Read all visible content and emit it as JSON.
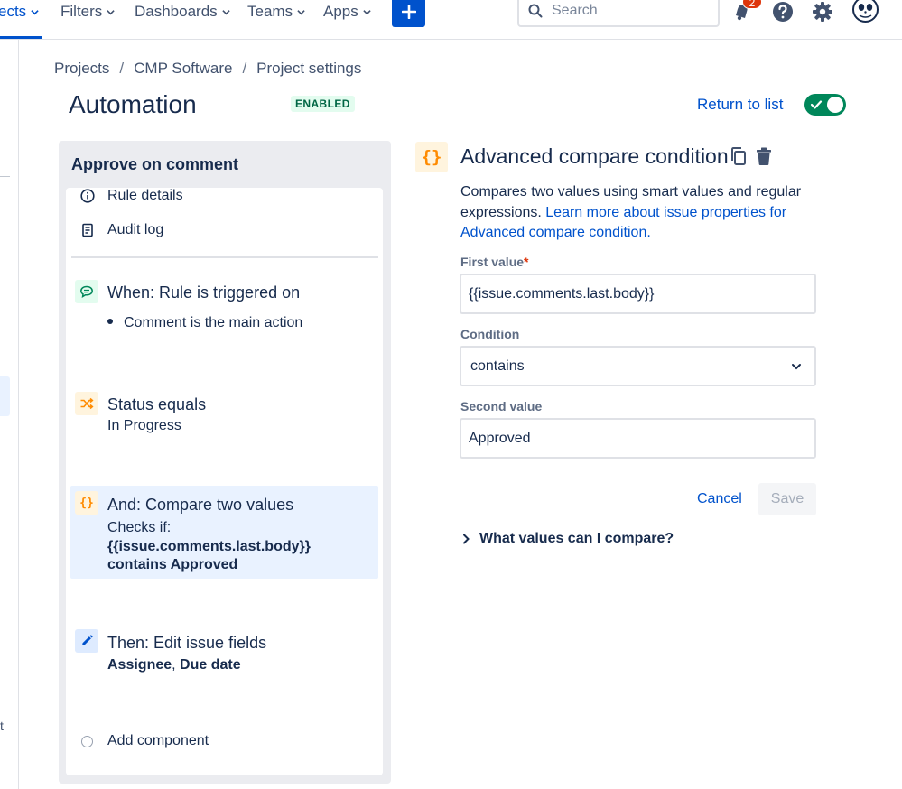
{
  "nav": {
    "items": [
      {
        "label": "ects"
      },
      {
        "label": "Filters"
      },
      {
        "label": "Dashboards"
      },
      {
        "label": "Teams"
      },
      {
        "label": "Apps"
      }
    ],
    "search_placeholder": "Search",
    "notification_count": "2"
  },
  "left_rail": {
    "truncated_text": "t"
  },
  "breadcrumb": [
    "Projects",
    "CMP Software",
    "Project settings"
  ],
  "page": {
    "title": "Automation",
    "status_badge": "ENABLED",
    "return_link": "Return to list",
    "rule_enabled": true
  },
  "rule": {
    "name": "Approve on comment",
    "menu": [
      {
        "label": "Rule details",
        "icon": "info-icon"
      },
      {
        "label": "Audit log",
        "icon": "document-icon"
      }
    ],
    "components": [
      {
        "icon": "comment-icon",
        "title": "When: Rule is triggered on",
        "detail": "Comment is the main action"
      },
      {
        "icon": "branch-icon",
        "title": "Status equals",
        "detail": "In Progress"
      },
      {
        "icon": "braces-icon",
        "title": "And: Compare two values",
        "line1": "Checks if:",
        "line2": "{{issue.comments.last.body}}",
        "line3": "contains Approved",
        "selected": true
      },
      {
        "icon": "pencil-icon",
        "title": "Then: Edit issue fields",
        "field1": "Assignee",
        "separator": ", ",
        "field2": "Due date"
      }
    ],
    "add_component": "Add component"
  },
  "detail": {
    "icon_glyph": "{}",
    "title": "Advanced compare condition",
    "description": "Compares two values using smart values and regular expressions.",
    "learn_more": "Learn more about issue properties for Advanced compare condition.",
    "first_value": {
      "label": "First value",
      "required_mark": "*",
      "value": "{{issue.comments.last.body}}"
    },
    "condition": {
      "label": "Condition",
      "value": "contains"
    },
    "second_value": {
      "label": "Second value",
      "value": "Approved"
    },
    "cancel": "Cancel",
    "save": "Save",
    "faq": "What values can I compare?"
  },
  "colors": {
    "brand_blue": "#0052cc",
    "toggle_green": "#00875a",
    "selected_bg": "#e9f2ff",
    "warning_orange": "#ff8b00",
    "badge_red": "#de350b"
  }
}
